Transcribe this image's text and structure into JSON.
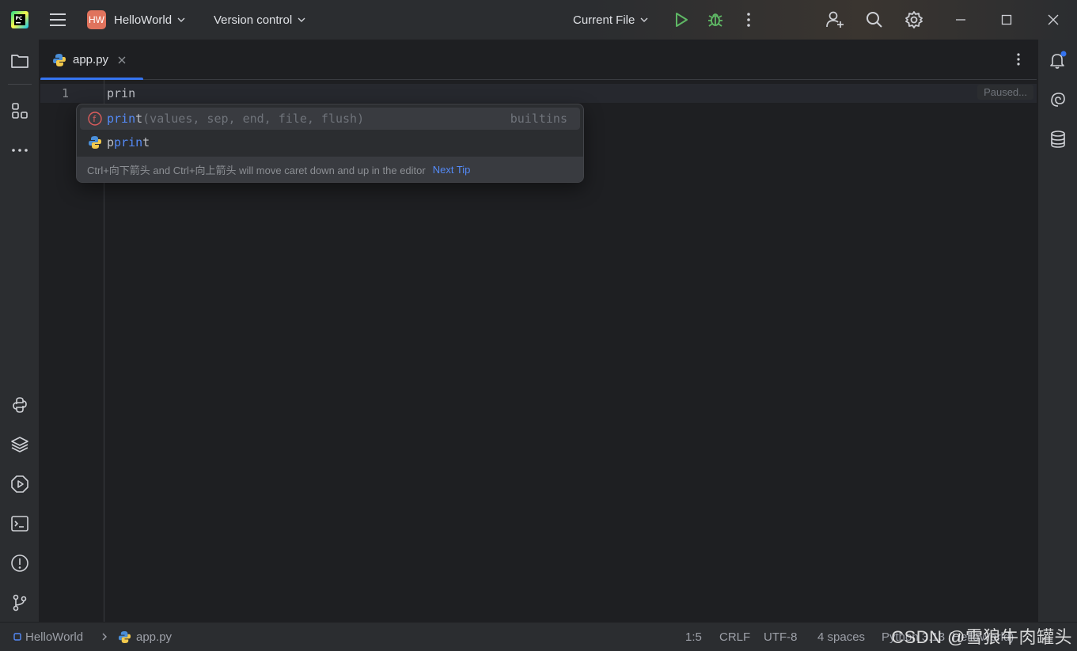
{
  "titlebar": {
    "project_badge": "HW",
    "project_name": "HelloWorld",
    "vcs_label": "Version control",
    "run_config": "Current File"
  },
  "tab": {
    "filename": "app.py"
  },
  "editor": {
    "line_number": "1",
    "code": "prin",
    "paused_label": "Paused..."
  },
  "completion": {
    "items": [
      {
        "highlight": "prin",
        "rest": "t",
        "signature": "(values, sep, end, file, flush)",
        "type": "builtins",
        "icon": "function-icon"
      },
      {
        "prefix": "p",
        "highlight": "prin",
        "rest": "t",
        "icon": "python-module-icon"
      }
    ],
    "tip_text": "Ctrl+向下箭头 and Ctrl+向上箭头 will move caret down and up in the editor",
    "next_tip": "Next Tip"
  },
  "statusbar": {
    "project": "HelloWorld",
    "file": "app.py",
    "position": "1:5",
    "line_ending": "CRLF",
    "encoding": "UTF-8",
    "indent": "4 spaces",
    "interpreter": "Python 3.13 (HelloWorld)"
  },
  "watermark": "CSDN @雪狼牛肉罐头",
  "colors": {
    "accent": "#3574f0",
    "run": "#5fb865",
    "badge": "#e0735d"
  }
}
